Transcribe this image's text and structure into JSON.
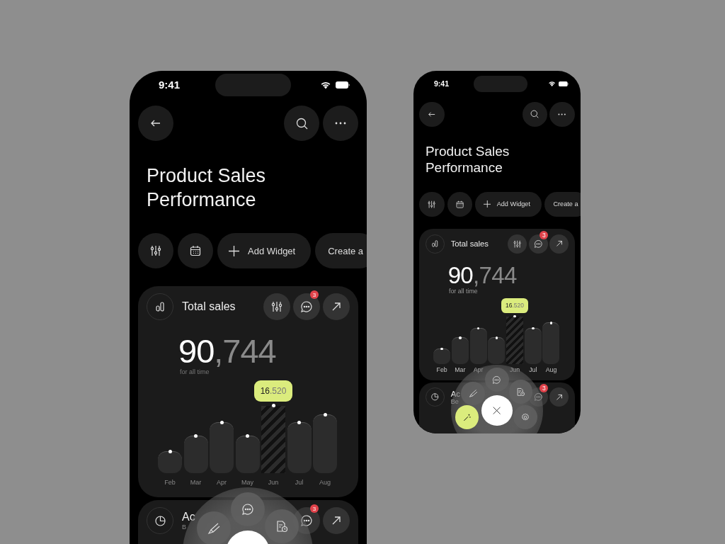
{
  "phones": [
    {
      "status_time": "9:41",
      "title": "Product Sales Performance",
      "chips": [
        {
          "kind": "add",
          "label": "Add Widget"
        },
        {
          "kind": "plain",
          "label": "Create a"
        }
      ],
      "sales_card": {
        "title": "Total sales",
        "badge": "3",
        "total_main": "90",
        "total_rest": ",744",
        "caption": "for all time",
        "tooltip_main": "16",
        "tooltip_rest": ".520",
        "months": [
          {
            "label": "Feb",
            "selected": false
          },
          {
            "label": "Mar",
            "selected": false
          },
          {
            "label": "Apr",
            "selected": false
          },
          {
            "label": "May",
            "selected": false
          },
          {
            "label": "Jun",
            "selected": true
          },
          {
            "label": "Jul",
            "selected": false
          },
          {
            "label": "Aug",
            "selected": false
          }
        ]
      },
      "second_card": {
        "title": "Ac",
        "subtitle": "B",
        "badge": "3"
      }
    },
    {
      "status_time": "9:41",
      "title": "Product Sales Performance",
      "chips": [
        {
          "kind": "add",
          "label": "Add Widget"
        },
        {
          "kind": "plain",
          "label": "Create a"
        }
      ],
      "sales_card": {
        "title": "Total sales",
        "badge": "3",
        "total_main": "90",
        "total_rest": ",744",
        "caption": "for all time",
        "tooltip_main": "16",
        "tooltip_rest": ".520",
        "months": [
          {
            "label": "Feb",
            "selected": false
          },
          {
            "label": "Mar",
            "selected": false
          },
          {
            "label": "Apr",
            "selected": false
          },
          {
            "selected": false
          },
          {
            "label": "Jun",
            "selected": true
          },
          {
            "label": "Jul",
            "selected": false
          },
          {
            "label": "Aug",
            "selected": false
          }
        ]
      },
      "second_card": {
        "title": "Ac",
        "subtitle": "Be",
        "badge": "3"
      }
    }
  ]
}
